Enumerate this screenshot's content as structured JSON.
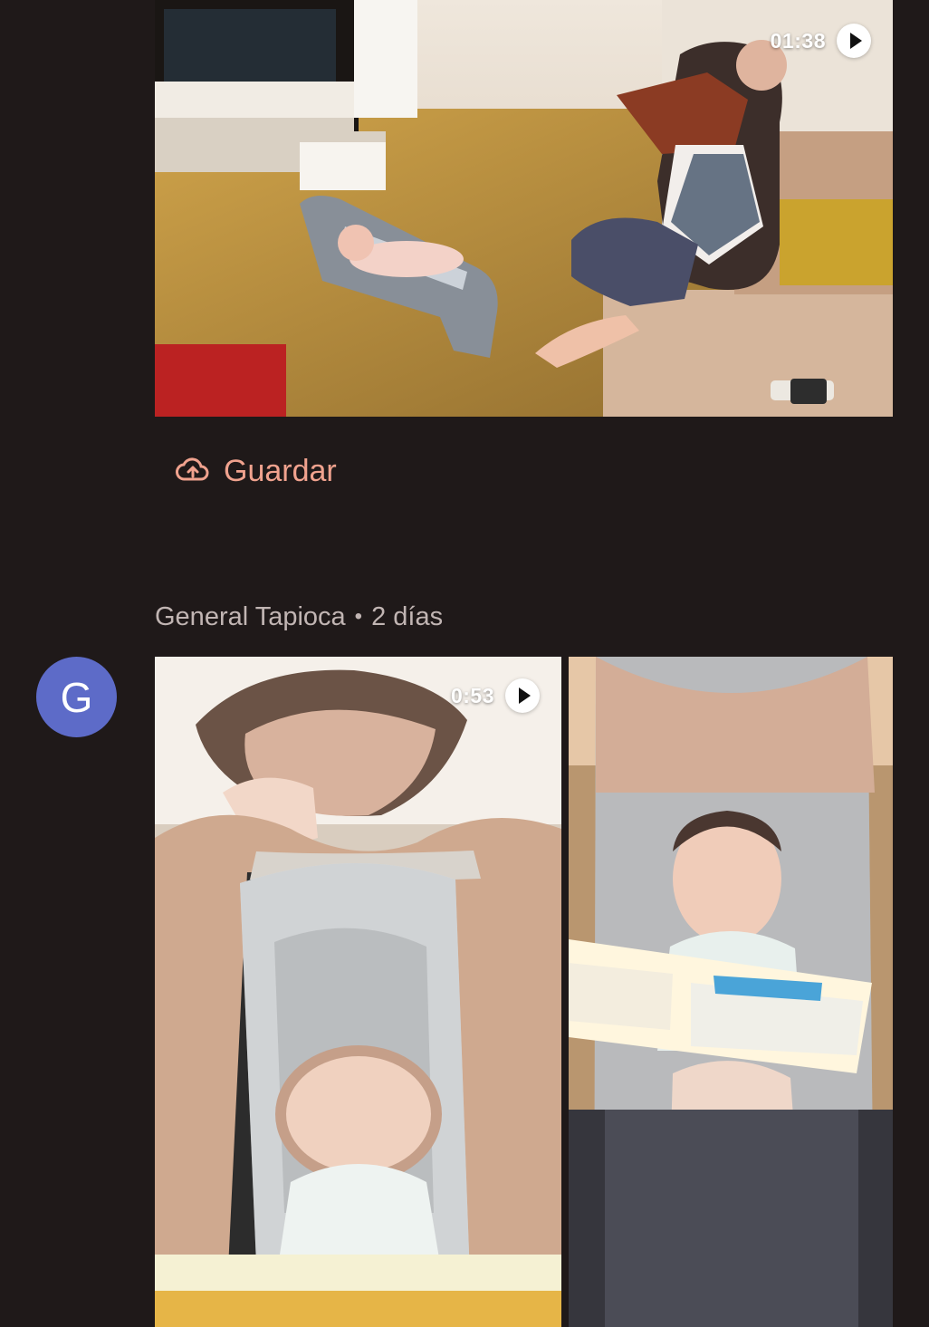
{
  "top_post": {
    "video_duration": "01:38",
    "save_label": "Guardar"
  },
  "post": {
    "author": "General Tapioca",
    "time_ago": "2 días",
    "separator": "•",
    "avatar_initial": "G"
  },
  "gallery": {
    "first_video_duration": "0:53"
  },
  "colors": {
    "background": "#1f1919",
    "save_accent": "#f0a28e",
    "avatar_background": "#5d6bc8",
    "meta_text": "#c1b5b3"
  },
  "icons": {
    "save": "cloud-upload-icon",
    "video": "play-icon"
  }
}
